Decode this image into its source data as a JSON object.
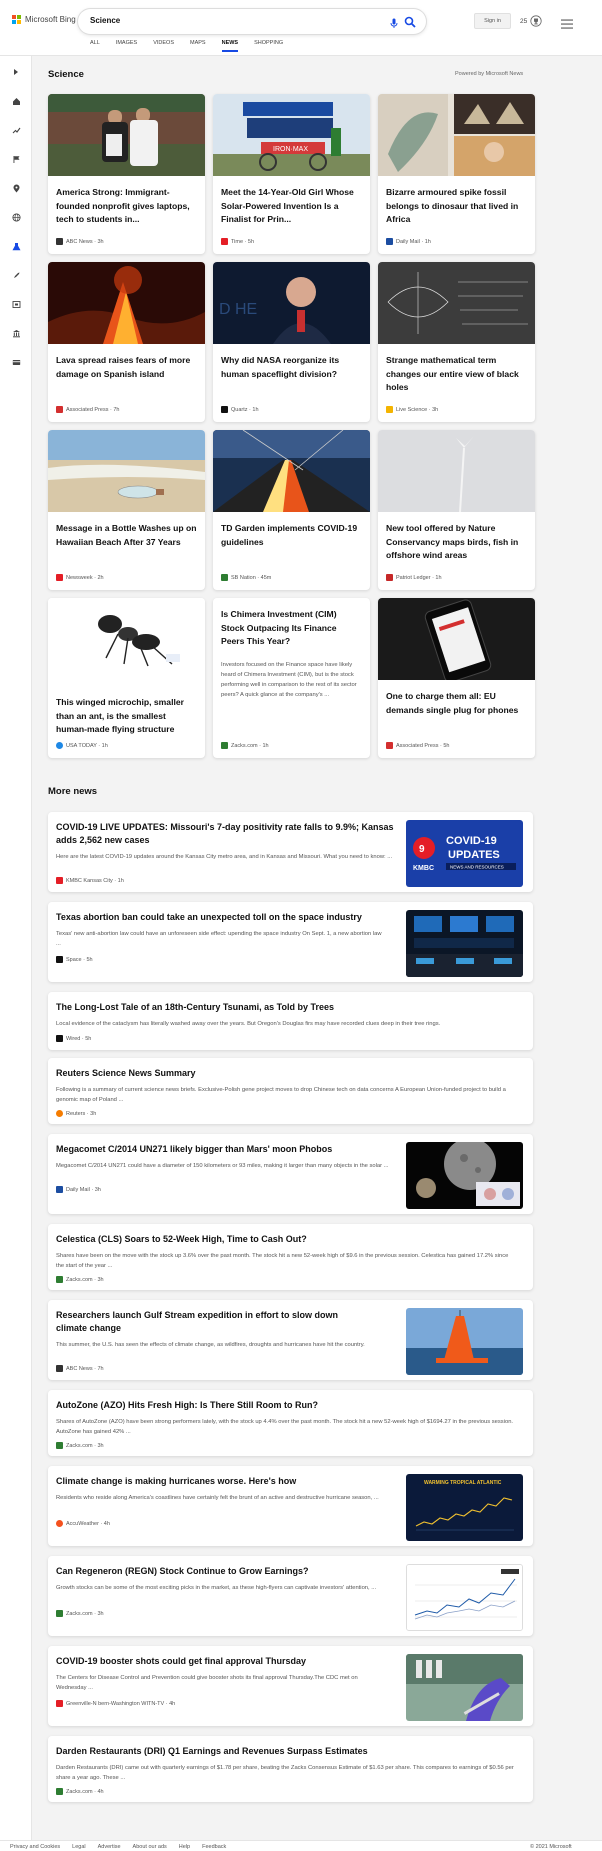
{
  "header": {
    "logo_text": "Microsoft Bing",
    "query": "Science",
    "signin_label": "Sign in",
    "rewards_count": "25",
    "tabs": [
      {
        "label": "ALL"
      },
      {
        "label": "IMAGES"
      },
      {
        "label": "VIDEOS"
      },
      {
        "label": "MAPS"
      },
      {
        "label": "NEWS"
      },
      {
        "label": "SHOPPING"
      }
    ],
    "active_tab": "NEWS",
    "accent_color": "#174ae4"
  },
  "science": {
    "title": "Science",
    "powered_by": "Powered by Microsoft News",
    "cards": [
      {
        "title": "America Strong: Immigrant-founded nonprofit gives laptops, tech to students in...",
        "source": "ABC News · 3h",
        "icon_color": "#333"
      },
      {
        "title": "Meet the 14-Year-Old Girl Whose Solar-Powered Invention Is a Finalist for Prin...",
        "source": "Time · 5h",
        "icon_color": "#e41e26"
      },
      {
        "title": "Bizarre armoured spike fossil belongs to dinosaur that lived in Africa",
        "source": "Daily Mail · 1h",
        "icon_color": "#1c4da1"
      },
      {
        "title": "Lava spread raises fears of more damage on Spanish island",
        "source": "Associated Press · 7h",
        "icon_color": "#d32f2f"
      },
      {
        "title": "Why did NASA reorganize its human spaceflight division?",
        "source": "Quartz · 1h",
        "icon_color": "#111"
      },
      {
        "title": "Strange mathematical term changes our entire view of black holes",
        "source": "Live Science · 3h",
        "icon_color": "#f4b400"
      },
      {
        "title": "Message in a Bottle Washes up on Hawaiian Beach After 37 Years",
        "source": "Newsweek · 2h",
        "icon_color": "#e41e26"
      },
      {
        "title": "TD Garden implements COVID-19 guidelines",
        "source": "SB Nation · 45m",
        "icon_color": "#2e7d32"
      },
      {
        "title": "New tool offered by Nature Conservancy maps birds, fish in offshore wind areas",
        "source": "Patriot Ledger · 1h",
        "icon_color": "#c62828"
      },
      {
        "title": "This winged microchip, smaller than an ant, is the smallest human-made flying structure",
        "source": "USA TODAY · 1h",
        "icon_color": "#1e88e5"
      },
      {
        "title": "Is Chimera Investment (CIM) Stock Outpacing Its Finance Peers This Year?",
        "description": "Investors focused on the Finance space have likely heard of Chimera Investment (CIM), but is the stock performing well in comparison to the rest of its sector peers? A quick glance at the company's ...",
        "source": "Zacks.com · 1h",
        "icon_color": "#2e7d32"
      },
      {
        "title": "One to charge them all: EU demands single plug for phones",
        "source": "Associated Press · 5h",
        "icon_color": "#d32f2f"
      }
    ]
  },
  "more_news": {
    "title": "More news",
    "items": [
      {
        "title": "COVID-19 LIVE UPDATES: Missouri's 7-day positivity rate falls to 9.9%; Kansas adds 2,562 new cases",
        "description": "Here are the latest COVID-19 updates around the Kansas City metro area, and in Kansas and Missouri. What you need to know: ...",
        "source": "KMBC Kansas City · 1h",
        "icon_color": "#e41e26",
        "thumb_text_1": "COVID-19",
        "thumb_text_2": "UPDATES",
        "thumb_text_3": "NEWS AND RESOURCES",
        "thumb_brand": "KMBC"
      },
      {
        "title": "Texas abortion ban could take an unexpected toll on the space industry",
        "description": "Texas' new anti-abortion law could have an unforeseen side effect: upending the space industry On Sept. 1, a new abortion law ...",
        "source": "Space · 5h",
        "icon_color": "#111"
      },
      {
        "title": "The Long-Lost Tale of an 18th-Century Tsunami, as Told by Trees",
        "description": "Local evidence of the cataclysm has literally washed away over the years. But Oregon's Douglas firs may have recorded clues deep in their tree rings.",
        "source": "Wired · 5h",
        "icon_color": "#111"
      },
      {
        "title": "Reuters Science News Summary",
        "description": "Following is a summary of current science news briefs. Exclusive-Polish gene project moves to drop Chinese tech on data concerns A European Union-funded project to build a genomic map of Poland ...",
        "source": "Reuters · 3h",
        "icon_color": "#f57c00"
      },
      {
        "title": "Megacomet C/2014 UN271 likely bigger than Mars' moon Phobos",
        "description": "Megacomet C/2014 UN271 could have a diameter of 150 kilometers or 93 miles, making it larger than many objects in the solar ...",
        "source": "Daily Mail · 3h",
        "icon_color": "#1c4da1"
      },
      {
        "title": "Celestica (CLS) Soars to 52-Week High, Time to Cash Out?",
        "description": "Shares have been on the move with the stock up 3.6% over the past month. The stock hit a new 52-week high of $9.6 in the previous session. Celestica has gained 17.2% since the start of the year ...",
        "source": "Zacks.com · 3h",
        "icon_color": "#2e7d32"
      },
      {
        "title": "Researchers launch Gulf Stream expedition in effort to slow down climate change",
        "description": "This summer, the U.S. has seen the effects of climate change, as wildfires, droughts and hurricanes have hit the country.",
        "source": "ABC News · 7h",
        "icon_color": "#333"
      },
      {
        "title": "AutoZone (AZO) Hits Fresh High: Is There Still Room to Run?",
        "description": "Shares of AutoZone (AZO) have been strong performers lately, with the stock up 4.4% over the past month. The stock hit a new 52-week high of $1694.27 in the previous session. AutoZone has gained 42% ...",
        "source": "Zacks.com · 3h",
        "icon_color": "#2e7d32"
      },
      {
        "title": "Climate change is making hurricanes worse. Here's how",
        "description": "Residents who reside along America's coastlines have certainly felt the brunt of an active and destructive hurricane season, ...",
        "source": "AccuWeather · 4h",
        "icon_color": "#f4511e",
        "thumb_text_1": "WARMING TROPICAL ATLANTIC"
      },
      {
        "title": "Can Regeneron (REGN) Stock Continue to Grow Earnings?",
        "description": "Growth stocks can be some of the most exciting picks in the market, as these high-flyers can captivate investors' attention, ...",
        "source": "Zacks.com · 3h",
        "icon_color": "#2e7d32"
      },
      {
        "title": "COVID-19 booster shots could get final approval Thursday",
        "description": "The Centers for Disease Control and Prevention could give booster shots its final approval Thursday.The CDC met on Wednesday ...",
        "source": "Greenville-N bern-Washington WITN-TV · 4h",
        "icon_color": "#e41e26"
      },
      {
        "title": "Darden Restaurants (DRI) Q1 Earnings and Revenues Surpass Estimates",
        "description": "Darden Restaurants (DRI) came out with quarterly earnings of $1.78 per share, beating the Zacks Consensus Estimate of $1.63 per share. This compares to earnings of $0.56 per share a year ago. These ...",
        "source": "Zacks.com · 4h",
        "icon_color": "#2e7d32"
      }
    ]
  },
  "footer": {
    "links": [
      "Privacy and Cookies",
      "Legal",
      "Advertise",
      "About our ads",
      "Help",
      "Feedback"
    ],
    "copyright": "© 2021 Microsoft"
  }
}
